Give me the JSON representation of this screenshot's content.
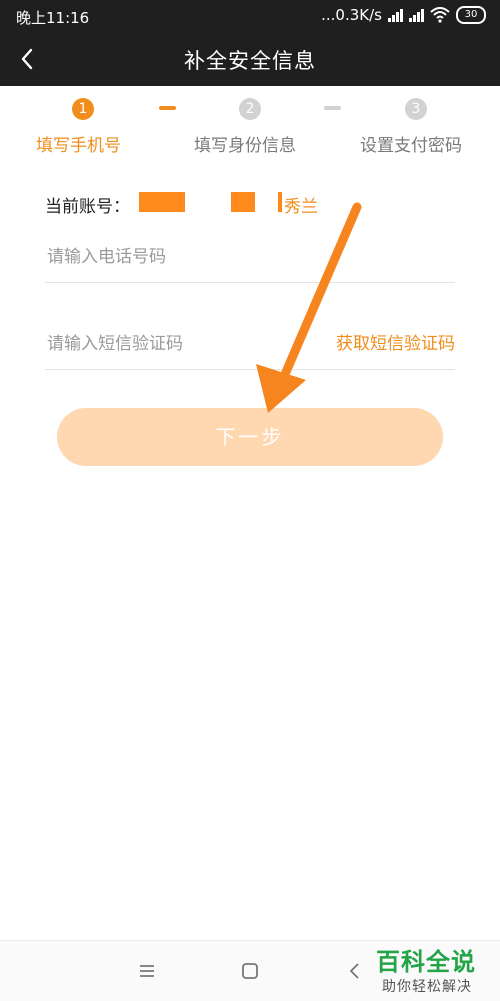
{
  "status_bar": {
    "time": "晚上11:16",
    "network_speed": "...0.3K/s",
    "battery": "30"
  },
  "header": {
    "title": "补全安全信息",
    "back_icon": "chevron-left-icon"
  },
  "steps": [
    {
      "number": "1",
      "label": "填写手机号",
      "state": "active"
    },
    {
      "number": "2",
      "label": "填写身份信息",
      "state": "inactive"
    },
    {
      "number": "3",
      "label": "设置支付密码",
      "state": "inactive"
    }
  ],
  "account": {
    "label": "当前账号：",
    "visible_suffix": "秀兰"
  },
  "form": {
    "phone_placeholder": "请输入电话号码",
    "sms_placeholder": "请输入短信验证码",
    "get_sms_label": "获取短信验证码",
    "next_label": "下一步"
  },
  "watermark": {
    "logo": "百科全说",
    "subtitle": "助你轻松解决"
  },
  "colors": {
    "accent": "#f08d1c",
    "button_disabled": "#ffd7b1",
    "header_bg": "#1f1f1f",
    "arrow": "#f7851f",
    "watermark": "#22a447"
  }
}
